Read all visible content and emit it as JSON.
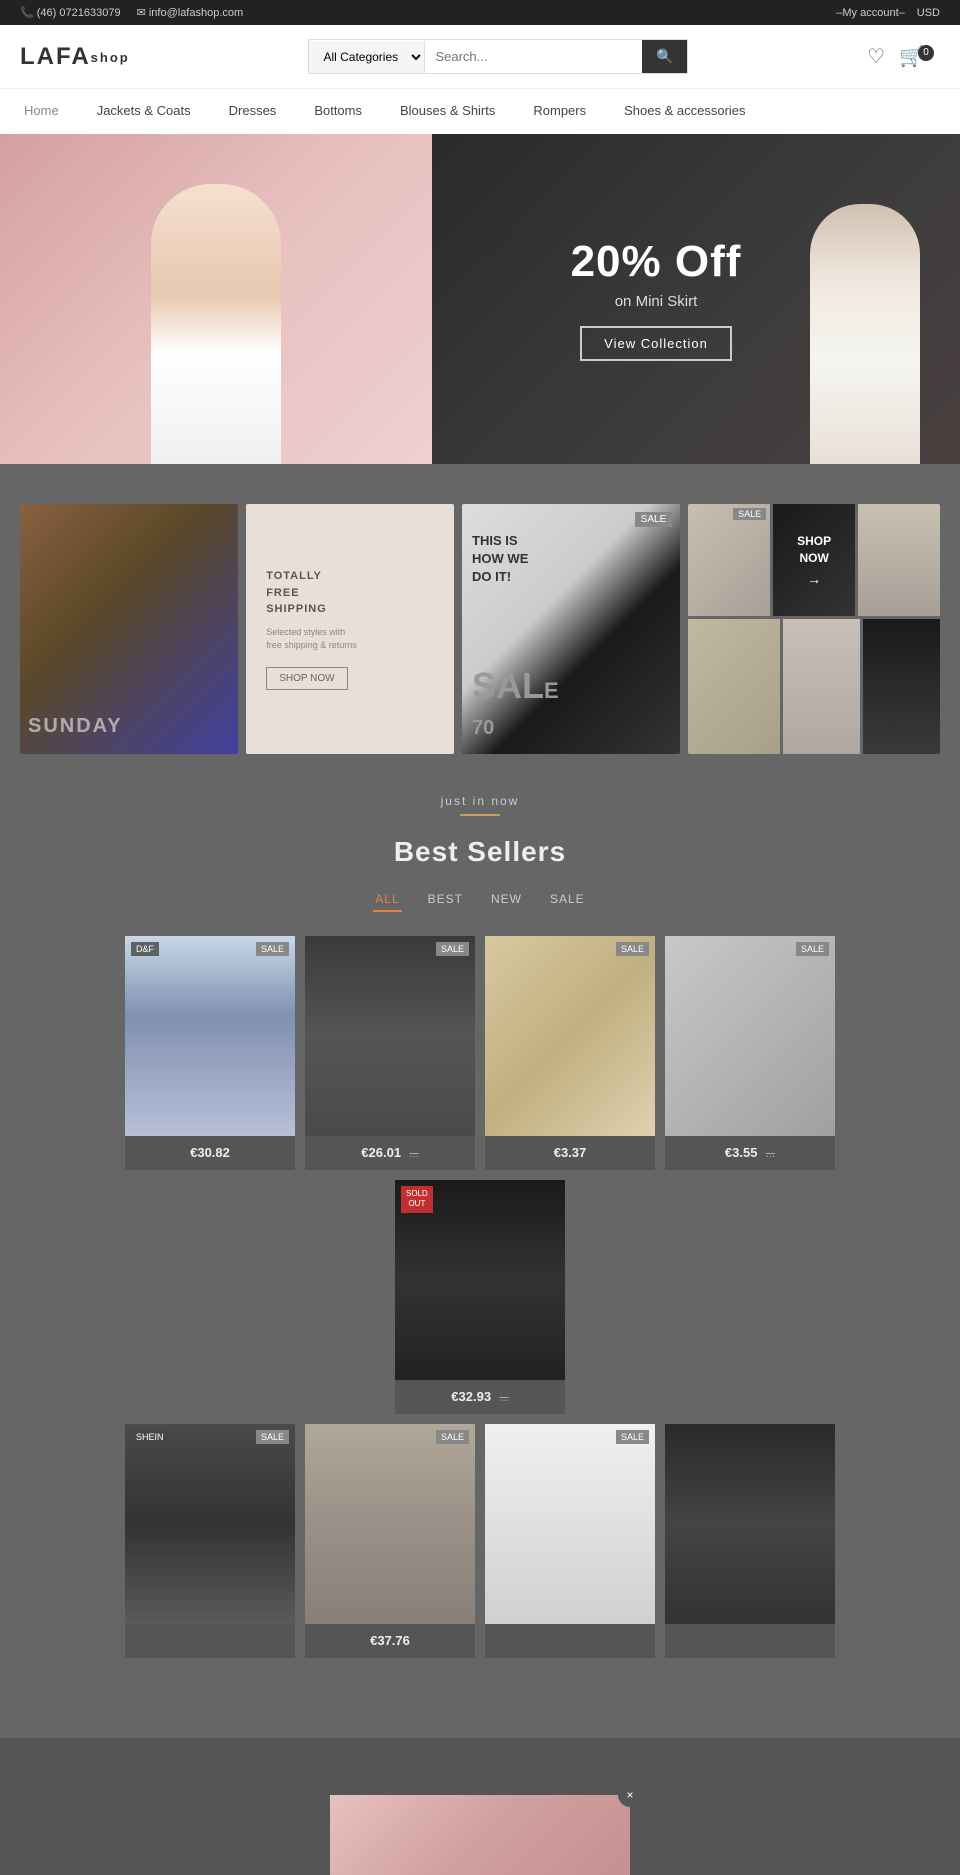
{
  "topbar": {
    "phone": "(46) 0721633079",
    "email": "info@lafashop.com",
    "account": "–My account–",
    "currency": "USD",
    "phone_icon": "📞",
    "email_icon": "✉"
  },
  "header": {
    "logo_lafa": "LAFA",
    "logo_shop": "shop",
    "search_placeholder": "Search...",
    "search_categories": "All Categories",
    "cart_count": "0",
    "wishlist_icon": "♡",
    "cart_icon": "🛒",
    "search_icon": "🔍"
  },
  "nav": {
    "items": [
      {
        "label": "Home",
        "class": "home"
      },
      {
        "label": "Jackets & Coats"
      },
      {
        "label": "Dresses"
      },
      {
        "label": "Bottoms"
      },
      {
        "label": "Blouses & Shirts"
      },
      {
        "label": "Rompers"
      },
      {
        "label": "Shoes & accessories"
      }
    ]
  },
  "hero": {
    "discount": "20% Off",
    "subtitle": "on Mini Skirt",
    "cta_label": "View Collection"
  },
  "promo": {
    "item1_label": "SUNDAY",
    "item2_title": "TOTALLY\nFREE\nSHIPPING",
    "item2_subtitle": "Selected styles with\nfree shipping & returns",
    "item2_btn": "SHOP NOW",
    "item3_sale": "SAL",
    "item3_pct": "70",
    "item3_this": "THIS IS\nHOW WE\nDO IT!",
    "item3_sale_badge": "SALE",
    "item4_shop_now": "SHOP\nNOW",
    "item4_arrow": "→",
    "item4_sale_badge": "SALE"
  },
  "bestsellers": {
    "just_in": "just in now",
    "title": "Best Sellers",
    "filters": [
      "ALL",
      "BEST",
      "NEW",
      "SALE"
    ],
    "active_filter": "ALL"
  },
  "products": {
    "row1": [
      {
        "id": "p1",
        "price": "€30.82",
        "old_price": "",
        "badge": "SALE",
        "badge_type": "sale",
        "brand": "D&F",
        "style": "blue"
      },
      {
        "id": "p2",
        "price": "€26.01",
        "old_price": "...",
        "badge": "SALE",
        "badge_type": "sale",
        "brand": "",
        "style": "dark"
      },
      {
        "id": "p3",
        "price": "€3.37",
        "old_price": "",
        "badge": "SALE",
        "badge_type": "sale",
        "brand": "",
        "style": "jewelry"
      },
      {
        "id": "p4",
        "price": "€3.55",
        "old_price": "...",
        "badge": "SALE",
        "badge_type": "sale",
        "brand": "",
        "style": "earring"
      },
      {
        "id": "p5",
        "price": "€32.93",
        "old_price": "...",
        "badge": "SOLD\nOUT",
        "badge_type": "soldout",
        "brand": "",
        "style": "boot"
      }
    ],
    "row2": [
      {
        "id": "p6",
        "price": "",
        "old_price": "",
        "badge": "",
        "badge_type": "",
        "brand": "SHEIN",
        "style": "jacket2"
      },
      {
        "id": "p7",
        "price": "€37.76",
        "old_price": "",
        "badge": "SALE",
        "badge_type": "sale",
        "brand": "",
        "style": "grey-jacket"
      },
      {
        "id": "p8",
        "price": "",
        "old_price": "",
        "badge": "SALE",
        "badge_type": "sale",
        "brand": "",
        "style": "tshirt"
      },
      {
        "id": "p9",
        "price": "",
        "old_price": "",
        "badge": "",
        "badge_type": "",
        "brand": "",
        "style": "boots2"
      }
    ]
  },
  "popup": {
    "close_label": "×"
  }
}
